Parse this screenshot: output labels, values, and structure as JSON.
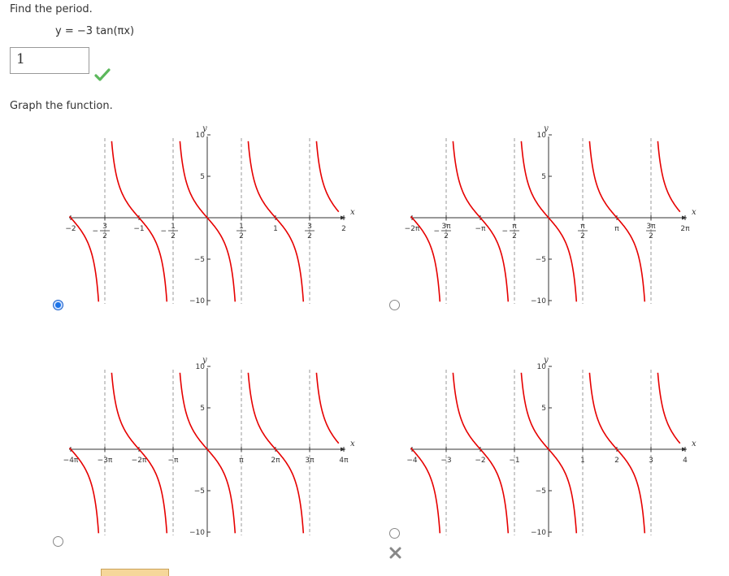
{
  "question": {
    "prompt": "Find the period.",
    "equation": "y = −3 tan(πx)"
  },
  "answer": {
    "value": "1",
    "status": "correct"
  },
  "graph_prompt": "Graph the function.",
  "colors": {
    "curve": "#e60000",
    "selected": "#1a73e8",
    "correct": "#5cb85c",
    "wrong": "#888888"
  },
  "graphs": [
    {
      "id": "A",
      "selected": true,
      "xtick_labels": [
        "−2",
        "3|2",
        "−1",
        "1|2",
        "1|2",
        "1",
        "3|2",
        "2"
      ],
      "xtick_neg": [
        false,
        true,
        false,
        true,
        false,
        false,
        false,
        false
      ],
      "ytick_labels": [
        "10",
        "5",
        "−5",
        "−10"
      ],
      "xlabel": "x",
      "ylabel": "y"
    },
    {
      "id": "B",
      "selected": false,
      "xtick_labels": [
        "−2π",
        "3π|2",
        "−π",
        "π|2",
        "π|2",
        "π",
        "3π|2",
        "2π"
      ],
      "xtick_neg": [
        false,
        true,
        false,
        true,
        false,
        false,
        false,
        false
      ],
      "ytick_labels": [
        "10",
        "5",
        "−5",
        "−10"
      ],
      "xlabel": "x",
      "ylabel": "y"
    },
    {
      "id": "C",
      "selected": false,
      "xtick_labels": [
        "−4π",
        "−3π",
        "−2π",
        "−π",
        "π",
        "2π",
        "3π",
        "4π"
      ],
      "xtick_neg": [
        false,
        false,
        false,
        false,
        false,
        false,
        false,
        false
      ],
      "ytick_labels": [
        "10",
        "5",
        "−5",
        "−10"
      ],
      "xlabel": "x",
      "ylabel": "y"
    },
    {
      "id": "D",
      "selected": false,
      "marked_wrong": true,
      "xtick_labels": [
        "−4",
        "−3",
        "−2",
        "−1",
        "1",
        "2",
        "3",
        "4"
      ],
      "xtick_neg": [
        false,
        false,
        false,
        false,
        false,
        false,
        false,
        false
      ],
      "ytick_labels": [
        "10",
        "5",
        "−5",
        "−10"
      ],
      "xlabel": "x",
      "ylabel": "y"
    }
  ]
}
